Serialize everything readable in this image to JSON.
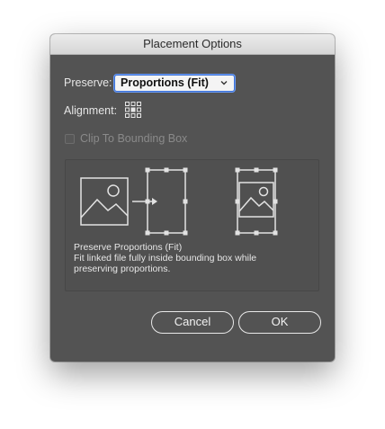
{
  "dialog": {
    "title": "Placement Options",
    "preserve_label": "Preserve:",
    "preserve_value": "Proportions (Fit)",
    "alignment_label": "Alignment:",
    "clip_label": "Clip To Bounding Box",
    "clip_checked": false,
    "clip_enabled": false,
    "description": {
      "heading": "Preserve Proportions (Fit)",
      "line1": "Fit linked file fully inside bounding box while",
      "line2": "preserving proportions."
    },
    "buttons": {
      "cancel": "Cancel",
      "ok": "OK"
    }
  },
  "icons": {
    "chevron": "chevron-down-icon",
    "alignment": "alignment-grid-icon",
    "image_source": "image-placeholder-icon",
    "arrow": "arrow-right-icon",
    "bounding_box": "bounding-box-icon",
    "fitted_result": "fitted-image-icon"
  },
  "colors": {
    "dialog_bg": "#535353",
    "accent": "#3b6fd4",
    "text": "#e6e6e6",
    "disabled_text": "#8a8a8a"
  }
}
